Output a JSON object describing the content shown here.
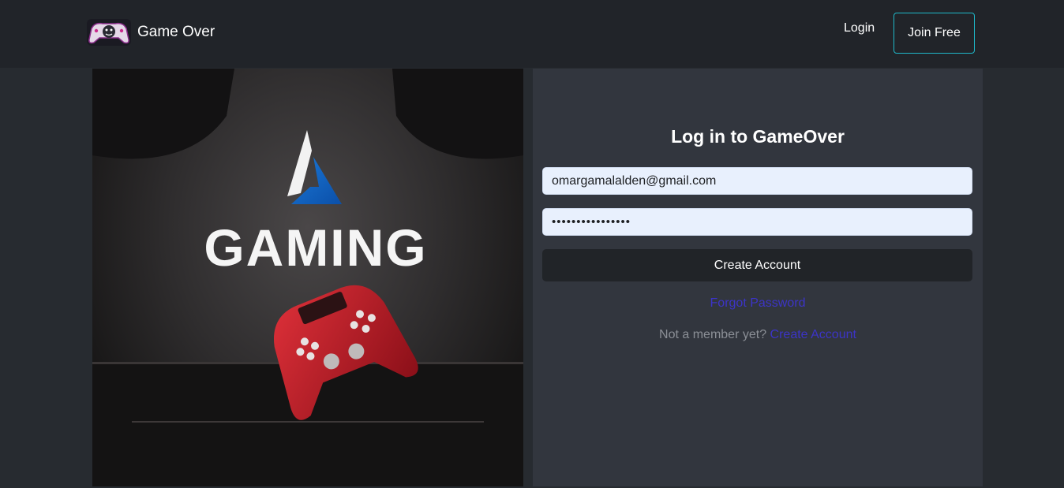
{
  "navbar": {
    "brand_name": "Game Over",
    "login_label": "Login",
    "join_label": "Join Free"
  },
  "hero": {
    "logo_text": "GAMING"
  },
  "login_form": {
    "title": "Log in to GameOver",
    "email_value": "omargamalalden@gmail.com",
    "password_value": "••••••••••••••••",
    "submit_label": "Create Account",
    "forgot_label": "Forgot Password",
    "signup_prompt": "Not a member yet?",
    "signup_link": "Create Account"
  },
  "colors": {
    "accent_border": "#1fb8c9",
    "link": "#3c34c7",
    "navbar_bg": "#212429",
    "panel_bg": "#32363e",
    "input_bg": "#e8f0fd"
  }
}
